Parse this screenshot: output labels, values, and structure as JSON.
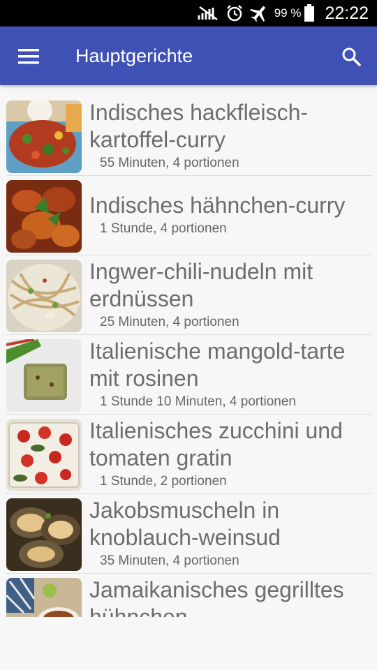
{
  "status_bar": {
    "battery_percent": "99 %",
    "time": "22:22",
    "icons": [
      "signal-off-icon",
      "alarm-icon",
      "airplane-mode-icon",
      "battery-icon"
    ]
  },
  "app_bar": {
    "title": "Hauptgerichte",
    "menu_icon": "menu-icon",
    "search_icon": "search-icon",
    "color": "#3f51b5"
  },
  "recipes": [
    {
      "title": "Indisches hackfleisch-kartoffel-curry",
      "meta": "55 Minuten, 4 portionen"
    },
    {
      "title": "Indisches hähnchen-curry",
      "meta": "1 Stunde, 4 portionen"
    },
    {
      "title": "Ingwer-chili-nudeln mit erdnüssen",
      "meta": "25 Minuten, 4 portionen"
    },
    {
      "title": "Italienische mangold-tarte mit rosinen",
      "meta": "1 Stunde 10 Minuten, 4 portionen"
    },
    {
      "title": "Italienisches zucchini und tomaten gratin",
      "meta": "1 Stunde, 2 portionen"
    },
    {
      "title": "Jakobsmuscheln in knoblauch-weinsud",
      "meta": "35 Minuten, 4 portionen"
    },
    {
      "title": "Jamaikanisches gegrilltes hühnchen",
      "meta": ""
    }
  ]
}
